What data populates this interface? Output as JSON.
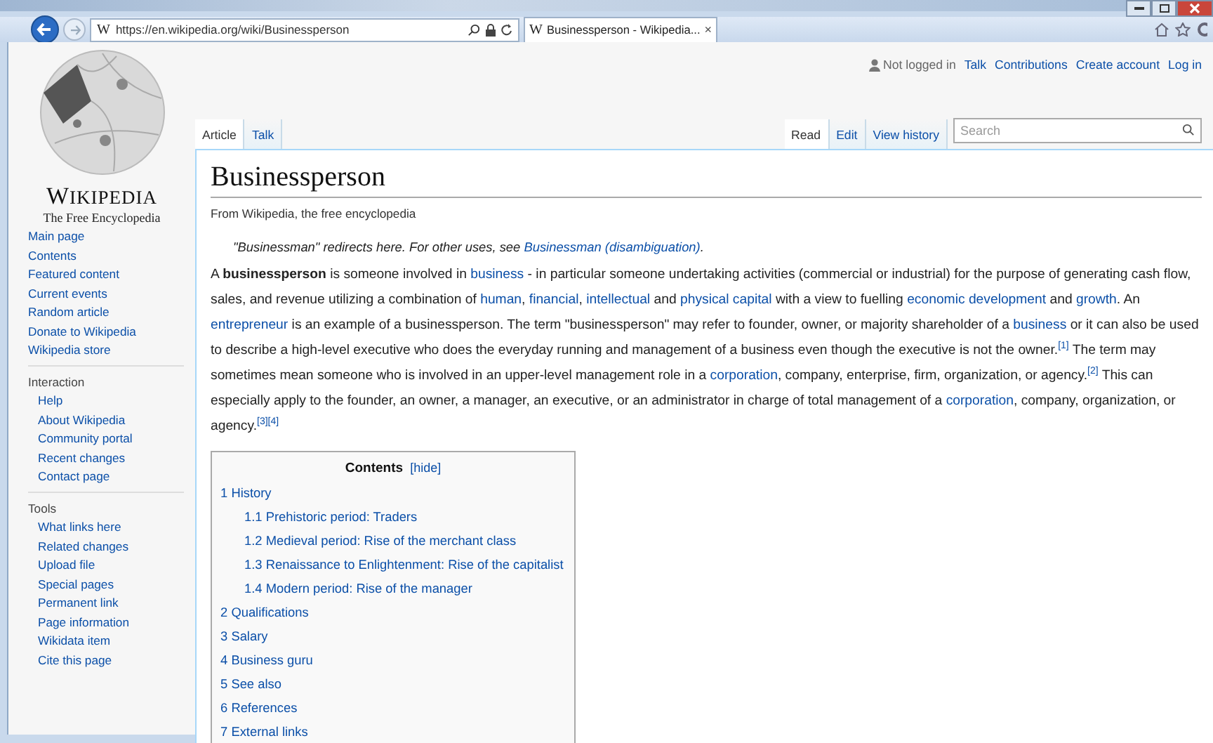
{
  "browser": {
    "address_favicon": "W",
    "tab_favicon": "W",
    "url": "https://en.wikipedia.org/wiki/Businessperson",
    "tab": "Businessperson - Wikipedia...",
    "tab_close": "×"
  },
  "personal": {
    "status": "Not logged in",
    "links": [
      "Talk",
      "Contributions",
      "Create account",
      "Log in"
    ]
  },
  "logo": {
    "wordmark": "WIKIPEDIA",
    "tagline": "The Free Encyclopedia"
  },
  "sidebar": {
    "sections": [
      {
        "items": [
          "Main page",
          "Contents",
          "Featured content",
          "Current events",
          "Random article",
          "Donate to Wikipedia",
          "Wikipedia store"
        ]
      },
      {
        "heading": "Interaction",
        "items": [
          "Help",
          "About Wikipedia",
          "Community portal",
          "Recent changes",
          "Contact page"
        ]
      },
      {
        "heading": "Tools",
        "items": [
          "What links here",
          "Related changes",
          "Upload file",
          "Special pages",
          "Permanent link",
          "Page information",
          "Wikidata item",
          "Cite this page"
        ]
      }
    ]
  },
  "tabs_left": [
    {
      "label": "Article",
      "selected": true
    },
    {
      "label": "Talk",
      "selected": false
    }
  ],
  "tabs_right": [
    {
      "label": "Read",
      "selected": true
    },
    {
      "label": "Edit",
      "selected": false
    },
    {
      "label": "View history",
      "selected": false
    }
  ],
  "search": {
    "placeholder": "Search"
  },
  "article": {
    "title": "Businessperson",
    "tagline": "From Wikipedia, the free encyclopedia",
    "hatnote": [
      {
        "kind": "text",
        "text": "\"Businessman\" redirects here. For other uses, see "
      },
      {
        "kind": "link",
        "text": "Businessman (disambiguation)"
      },
      {
        "kind": "text",
        "text": "."
      }
    ],
    "paragraph": [
      {
        "kind": "text",
        "text": "A "
      },
      {
        "kind": "bold",
        "text": "businessperson"
      },
      {
        "kind": "text",
        "text": " is someone involved in "
      },
      {
        "kind": "link",
        "text": "business"
      },
      {
        "kind": "text",
        "text": " - in particular someone undertaking activities (commercial or industrial) for the purpose of generating cash flow, sales, and revenue utilizing a combination of "
      },
      {
        "kind": "link",
        "text": "human"
      },
      {
        "kind": "text",
        "text": ", "
      },
      {
        "kind": "link",
        "text": "financial"
      },
      {
        "kind": "text",
        "text": ", "
      },
      {
        "kind": "link",
        "text": "intellectual"
      },
      {
        "kind": "text",
        "text": " and "
      },
      {
        "kind": "link",
        "text": "physical capital"
      },
      {
        "kind": "text",
        "text": " with a view to fuelling "
      },
      {
        "kind": "link",
        "text": "economic development"
      },
      {
        "kind": "text",
        "text": " and "
      },
      {
        "kind": "link",
        "text": "growth"
      },
      {
        "kind": "text",
        "text": ". An "
      },
      {
        "kind": "link",
        "text": "entrepreneur"
      },
      {
        "kind": "text",
        "text": " is an example of a businessperson. The term \"businessperson\" may refer to founder, owner, or majority shareholder of a "
      },
      {
        "kind": "link",
        "text": "business"
      },
      {
        "kind": "text",
        "text": " or it can also be used to describe a high-level executive who does the everyday running and management of a business even though the executive is not the owner."
      },
      {
        "kind": "ref",
        "text": "[1]"
      },
      {
        "kind": "text",
        "text": " The term may sometimes mean someone who is involved in an upper-level management role in a "
      },
      {
        "kind": "link",
        "text": "corporation"
      },
      {
        "kind": "text",
        "text": ", company, enterprise, firm, organization, or agency."
      },
      {
        "kind": "ref",
        "text": "[2]"
      },
      {
        "kind": "text",
        "text": " This can especially apply to the founder, an owner, a manager, an executive, or an administrator in charge of total management of a "
      },
      {
        "kind": "link",
        "text": "corporation"
      },
      {
        "kind": "text",
        "text": ", company, organization, or agency."
      },
      {
        "kind": "ref",
        "text": "[3][4]"
      }
    ]
  },
  "toc": {
    "title": "Contents",
    "toggle": "[hide]",
    "items": [
      {
        "number": "1",
        "text": "History",
        "children": [
          {
            "number": "1.1",
            "text": "Prehistoric period: Traders"
          },
          {
            "number": "1.2",
            "text": "Medieval period: Rise of the merchant class"
          },
          {
            "number": "1.3",
            "text": "Renaissance to Enlightenment: Rise of the capitalist"
          },
          {
            "number": "1.4",
            "text": "Modern period: Rise of the manager"
          }
        ]
      },
      {
        "number": "2",
        "text": "Qualifications"
      },
      {
        "number": "3",
        "text": "Salary"
      },
      {
        "number": "4",
        "text": "Business guru"
      },
      {
        "number": "5",
        "text": "See also"
      },
      {
        "number": "6",
        "text": "References"
      },
      {
        "number": "7",
        "text": "External links"
      }
    ]
  }
}
